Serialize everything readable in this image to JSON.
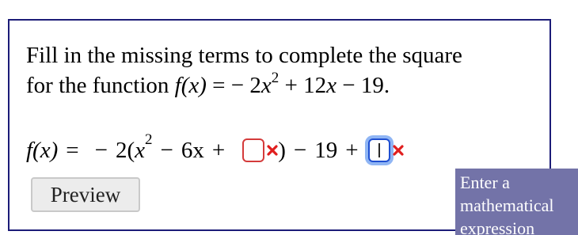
{
  "question": {
    "line1": "Fill in the missing terms to complete the square",
    "line2_prefix": "for the function ",
    "fx": "f(x)",
    "rhs_tokens": [
      "=",
      "−",
      "2",
      "x",
      "2",
      "+",
      "12",
      "x",
      "−",
      "19."
    ]
  },
  "equation": {
    "lhs": "f(x)",
    "eq": "=",
    "minus_sign": "−",
    "coef_open": "2(",
    "x": "x",
    "exp": "2",
    "minus1": "−",
    "six_x": "6x",
    "plus1": "+",
    "close_paren": ")",
    "minus2": "−",
    "nineteen": "19",
    "plus2": "+"
  },
  "inputs": {
    "blank1_value": "",
    "blank2_value": ""
  },
  "preview_button": {
    "label": "Preview"
  },
  "tooltip": {
    "text": "Enter a mathematical expression"
  },
  "colors": {
    "border": "#1c1c78",
    "error": "#d43b3b",
    "focus": "#1f4fd1",
    "tooltip_bg": "#7373a8"
  },
  "icons": [
    "error-x-icon",
    "error-x-icon"
  ]
}
